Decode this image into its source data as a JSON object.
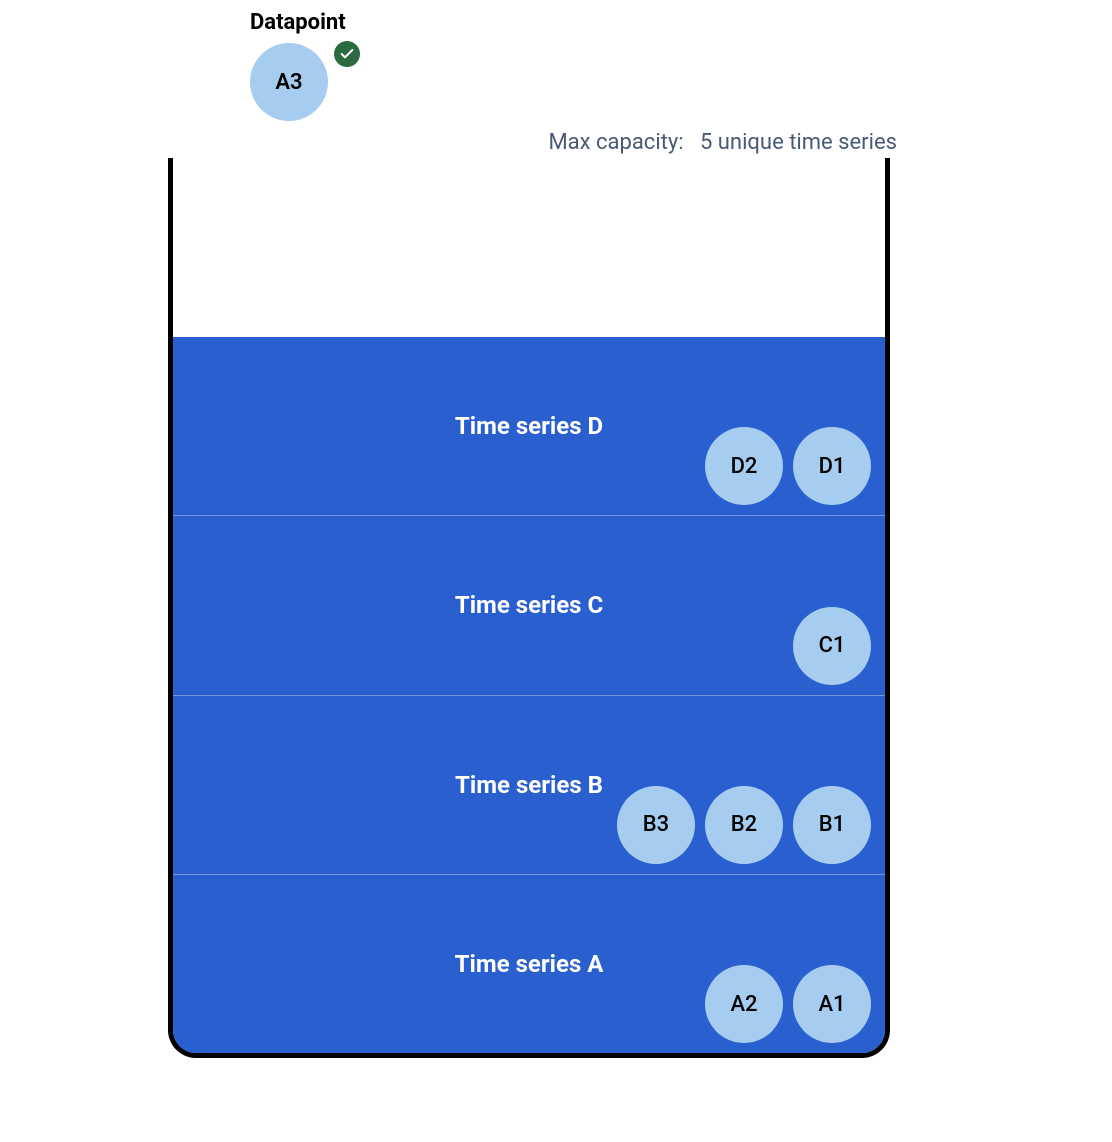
{
  "header": {
    "label": "Datapoint",
    "incoming_point": "A3",
    "status_icon": "check-icon"
  },
  "capacity": {
    "label": "Max capacity:",
    "value": "5 unique time series"
  },
  "bucket": {
    "fill_fraction": 0.8,
    "series": [
      {
        "label": "Time series D",
        "points": [
          "D1",
          "D2"
        ]
      },
      {
        "label": "Time series C",
        "points": [
          "C1"
        ]
      },
      {
        "label": "Time series B",
        "points": [
          "B1",
          "B2",
          "B3"
        ]
      },
      {
        "label": "Time series A",
        "points": [
          "A1",
          "A2"
        ]
      }
    ]
  },
  "colors": {
    "fill_blue": "#2a5fcf",
    "point_blue": "#a6ccf0",
    "check_green": "#2a6b3f",
    "capacity_text": "#4a5a75"
  }
}
